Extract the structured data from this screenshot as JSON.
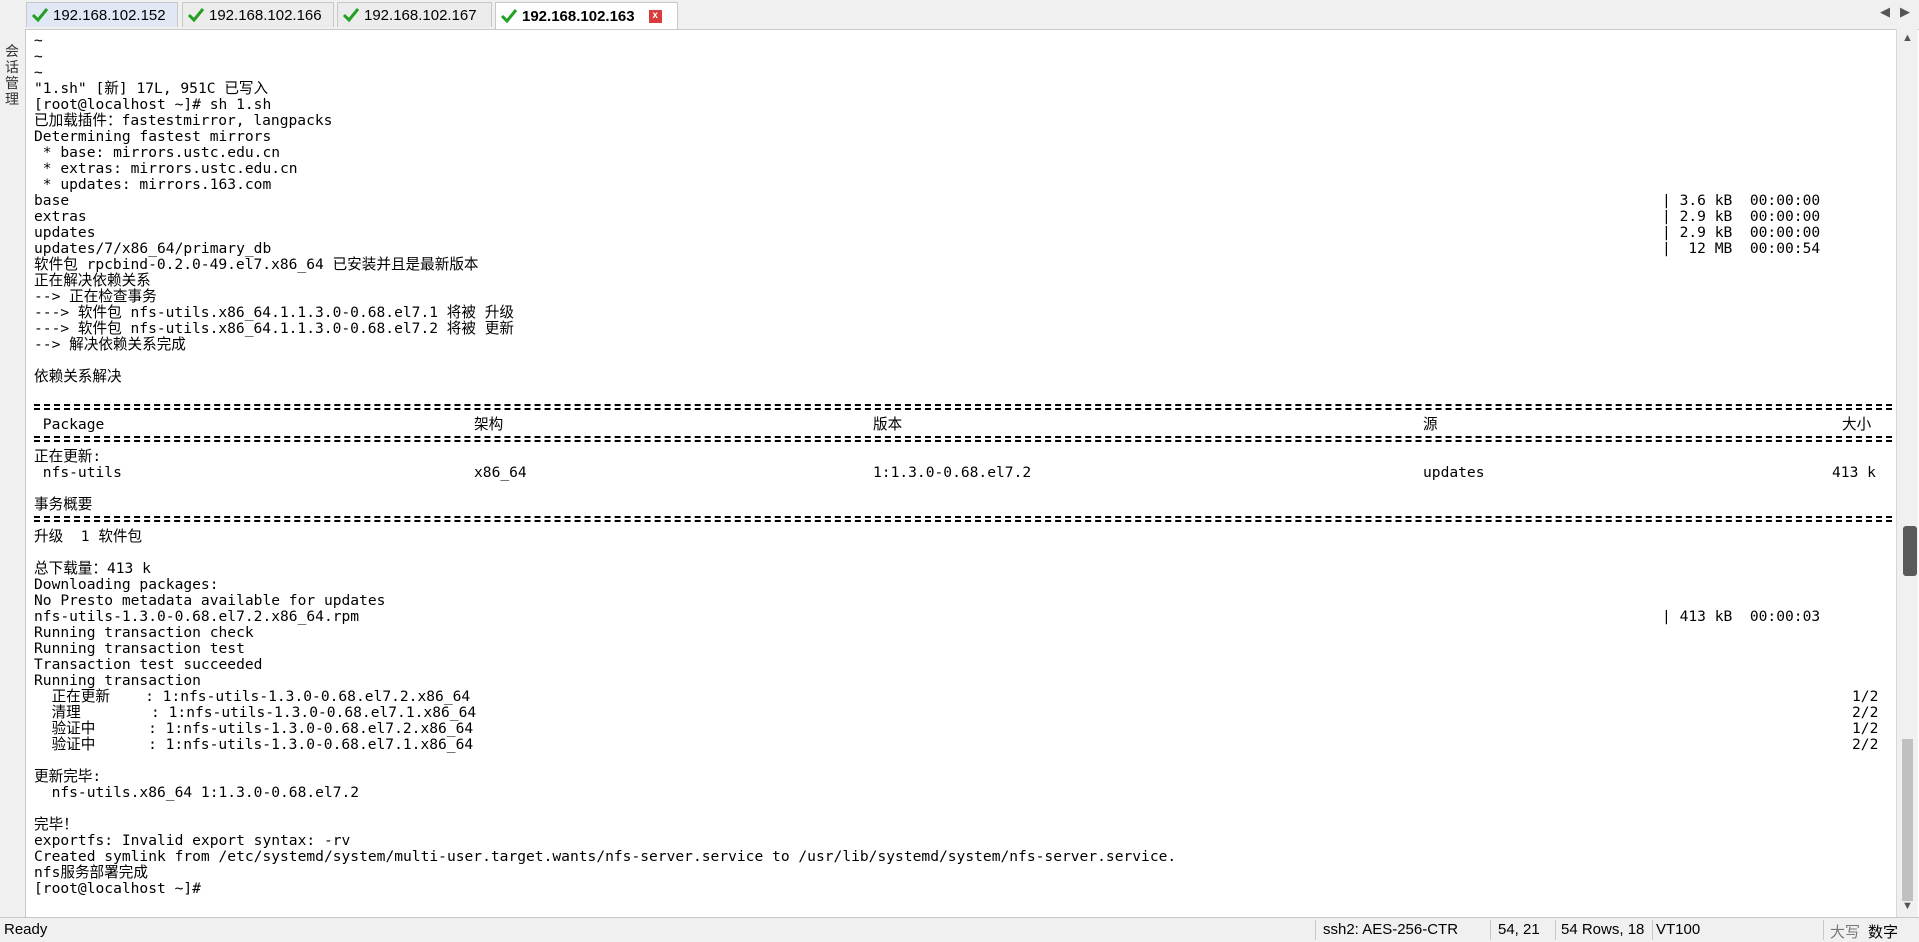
{
  "tabs": [
    {
      "label": "192.168.102.152"
    },
    {
      "label": "192.168.102.166"
    },
    {
      "label": "192.168.102.167"
    },
    {
      "label": "192.168.102.163"
    }
  ],
  "tab_close_label": "x",
  "side_label": "会话管理",
  "terminal": {
    "lines": [
      "~",
      "~",
      "~",
      "\"1.sh\" [新] 17L, 951C 已写入",
      "[root@localhost ~]# sh 1.sh",
      "已加载插件：fastestmirror, langpacks",
      "Determining fastest mirrors",
      " * base: mirrors.ustc.edu.cn",
      " * extras: mirrors.ustc.edu.cn",
      " * updates: mirrors.163.com",
      "base",
      "extras",
      "updates",
      "updates/7/x86_64/primary_db",
      "软件包 rpcbind-0.2.0-49.el7.x86_64 已安装并且是最新版本",
      "正在解决依赖关系",
      "--> 正在检查事务",
      "---> 软件包 nfs-utils.x86_64.1.1.3.0-0.68.el7.1 将被 升级",
      "---> 软件包 nfs-utils.x86_64.1.1.3.0-0.68.el7.2 将被 更新",
      "--> 解决依赖关系完成",
      "",
      "依赖关系解决",
      "",
      "",
      " Package",
      "",
      "正在更新:",
      " nfs-utils",
      "",
      "事务概要",
      "",
      "升级  1 软件包",
      "",
      "总下载量：413 k",
      "Downloading packages:",
      "No Presto metadata available for updates",
      "nfs-utils-1.3.0-0.68.el7.2.x86_64.rpm",
      "Running transaction check",
      "Running transaction test",
      "Transaction test succeeded",
      "Running transaction",
      "  正在更新    : 1:nfs-utils-1.3.0-0.68.el7.2.x86_64",
      "  清理        : 1:nfs-utils-1.3.0-0.68.el7.1.x86_64",
      "  验证中      : 1:nfs-utils-1.3.0-0.68.el7.2.x86_64",
      "  验证中      : 1:nfs-utils-1.3.0-0.68.el7.1.x86_64",
      "",
      "更新完毕:",
      "  nfs-utils.x86_64 1:1.3.0-0.68.el7.2",
      "",
      "完毕！",
      "exportfs: Invalid export syntax: -rv",
      "Created symlink from /etc/systemd/system/multi-user.target.wants/nfs-server.service to /usr/lib/systemd/system/nfs-server.service.",
      "nfs服务部署完成",
      "[root@localhost ~]#"
    ],
    "repo_stats": [
      {
        "text": "| 3.6 kB  00:00:00"
      },
      {
        "text": "| 2.9 kB  00:00:00"
      },
      {
        "text": "| 2.9 kB  00:00:00"
      },
      {
        "text": "|  12 MB  00:00:54"
      }
    ],
    "download_stat": "| 413 kB  00:00:03",
    "table_headers": {
      "arch": "架构",
      "version": "版本",
      "repo": "源",
      "size": "大小"
    },
    "package_row": {
      "arch": "x86_64",
      "version": "1:1.3.0-0.68.el7.2",
      "repo": "updates",
      "size": "413 k"
    },
    "progress": [
      "1/2",
      "2/2",
      "1/2",
      "2/2"
    ]
  },
  "status": {
    "ready": "Ready",
    "cipher": "ssh2: AES-256-CTR",
    "cursor": "54, 21",
    "size": "54 Rows, 18",
    "emulation": "VT100",
    "caps": "大写",
    "num": "数字"
  },
  "colors": {
    "check": "#22a022",
    "close": "#d83c3c"
  },
  "icons": {
    "tab_status": "check-icon",
    "nav_prev": "chevron-left-icon",
    "nav_next": "chevron-right-icon"
  }
}
